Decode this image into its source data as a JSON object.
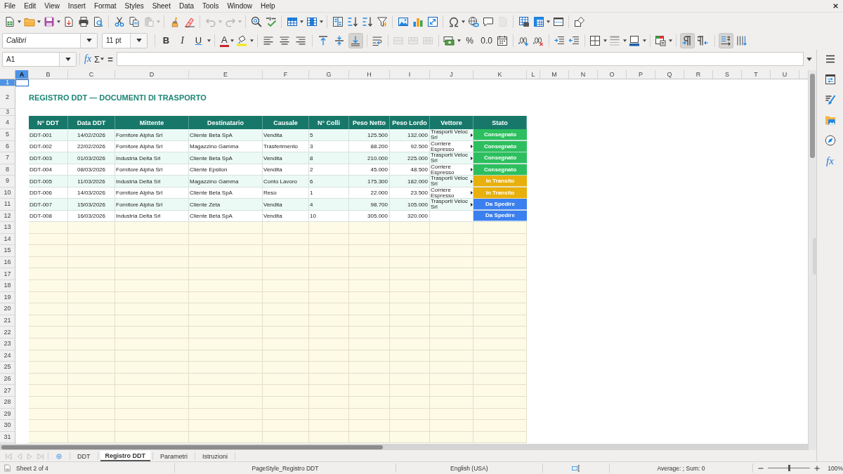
{
  "menu_bar": [
    "File",
    "Edit",
    "View",
    "Insert",
    "Format",
    "Styles",
    "Sheet",
    "Data",
    "Tools",
    "Window",
    "Help"
  ],
  "standard_toolbar": {
    "paste": {
      "disabled": true
    },
    "undo": {
      "disabled": true
    },
    "redo": {
      "disabled": true
    },
    "headers_footers": {
      "disabled": true
    }
  },
  "formatting_toolbar": {
    "font_name": "Calibri",
    "font_size": "11 pt",
    "bold": {
      "label": "B",
      "on": false
    },
    "italic": {
      "label": "I",
      "on": false
    },
    "underline": {
      "label": "U",
      "on": false
    },
    "font_color": {
      "label": "A"
    },
    "align_left": {
      "on": false
    },
    "align_center": {
      "on": false
    },
    "align_right": {
      "on": false
    },
    "align_top": {
      "on": false
    },
    "align_middle": {
      "on": false
    },
    "align_bottom": {
      "on": true
    },
    "merge": {
      "disabled": true
    },
    "percent": {
      "label": "%"
    },
    "decimal": {
      "label": "0.0"
    },
    "left_to_right": {
      "on": true
    },
    "right_to_left": {
      "on": false
    },
    "text_left_to_right": {
      "on": true
    },
    "text_top_to_bottom": {
      "on": false
    }
  },
  "formula_bar": {
    "cell_reference": "A1",
    "function_wizard": "fx",
    "sum": "Σ",
    "equals": "="
  },
  "column_headers": [
    {
      "label": "A",
      "selected": true
    },
    {
      "label": "B",
      "selected": false
    },
    {
      "label": "C",
      "selected": false
    },
    {
      "label": "D",
      "selected": false
    },
    {
      "label": "E",
      "selected": false
    },
    {
      "label": "F",
      "selected": false
    },
    {
      "label": "G",
      "selected": false
    },
    {
      "label": "H",
      "selected": false
    },
    {
      "label": "I",
      "selected": false
    },
    {
      "label": "J",
      "selected": false
    },
    {
      "label": "K",
      "selected": false
    },
    {
      "label": "L",
      "selected": false
    },
    {
      "label": "M",
      "selected": false
    },
    {
      "label": "N",
      "selected": false
    },
    {
      "label": "O",
      "selected": false
    },
    {
      "label": "P",
      "selected": false
    },
    {
      "label": "Q",
      "selected": false
    },
    {
      "label": "R",
      "selected": false
    },
    {
      "label": "S",
      "selected": false
    },
    {
      "label": "T",
      "selected": false
    },
    {
      "label": "U",
      "selected": false
    }
  ],
  "row_headers": [
    {
      "label": "1",
      "selected": true
    },
    {
      "label": "2",
      "selected": false
    },
    {
      "label": "3",
      "selected": false
    },
    {
      "label": "4",
      "selected": false
    },
    {
      "label": "5",
      "selected": false
    },
    {
      "label": "6",
      "selected": false
    },
    {
      "label": "7",
      "selected": false
    },
    {
      "label": "8",
      "selected": false
    },
    {
      "label": "9",
      "selected": false
    },
    {
      "label": "10",
      "selected": false
    },
    {
      "label": "11",
      "selected": false
    },
    {
      "label": "12",
      "selected": false
    },
    {
      "label": "13",
      "selected": false
    },
    {
      "label": "14",
      "selected": false
    },
    {
      "label": "15",
      "selected": false
    },
    {
      "label": "16",
      "selected": false
    },
    {
      "label": "17",
      "selected": false
    },
    {
      "label": "18",
      "selected": false
    },
    {
      "label": "19",
      "selected": false
    },
    {
      "label": "20",
      "selected": false
    },
    {
      "label": "21",
      "selected": false
    },
    {
      "label": "22",
      "selected": false
    },
    {
      "label": "23",
      "selected": false
    },
    {
      "label": "24",
      "selected": false
    },
    {
      "label": "25",
      "selected": false
    },
    {
      "label": "26",
      "selected": false
    },
    {
      "label": "27",
      "selected": false
    },
    {
      "label": "28",
      "selected": false
    },
    {
      "label": "29",
      "selected": false
    },
    {
      "label": "30",
      "selected": false
    },
    {
      "label": "31",
      "selected": false
    }
  ],
  "sheet": {
    "title": "REGISTRO DDT — DOCUMENTI DI TRASPORTO",
    "table": {
      "columns": [
        "N° DDT",
        "Data DDT",
        "Mittente",
        "Destinatario",
        "Causale",
        "N° Colli",
        "Peso Netto",
        "Peso Lordo",
        "Vettore",
        "Stato"
      ],
      "rows": [
        {
          "ddt": "DDT-001",
          "date": "14/02/2026",
          "sender": "Fornitore Alpha Srl",
          "recipient": "Cliente Beta SpA",
          "reason": "Vendita",
          "packages": "5",
          "net": "125.500",
          "gross": "132.000",
          "carrier": {
            "text": "Trasporti Veloc Srl",
            "clipped": true
          },
          "status": {
            "text": "Consegnato",
            "color": "#2dbf5f"
          }
        },
        {
          "ddt": "DDT-002",
          "date": "22/02/2026",
          "sender": "Fornitore Alpha Srl",
          "recipient": "Magazzino Gamma",
          "reason": "Trasferimento",
          "packages": "3",
          "net": "88.200",
          "gross": "92.500",
          "carrier": {
            "text": "Corriere Espresso",
            "clipped": true
          },
          "status": {
            "text": "Consegnato",
            "color": "#2dbf5f"
          }
        },
        {
          "ddt": "DDT-003",
          "date": "01/03/2026",
          "sender": "Industria Delta Srl",
          "recipient": "Cliente Beta SpA",
          "reason": "Vendita",
          "packages": "8",
          "net": "210.000",
          "gross": "225.000",
          "carrier": {
            "text": "Trasporti Veloc Srl",
            "clipped": true
          },
          "status": {
            "text": "Consegnato",
            "color": "#2dbf5f"
          }
        },
        {
          "ddt": "DDT-004",
          "date": "08/03/2026",
          "sender": "Fornitore Alpha Srl",
          "recipient": "Cliente Epsilon",
          "reason": "Vendita",
          "packages": "2",
          "net": "45.000",
          "gross": "48.500",
          "carrier": {
            "text": "Corriere Espresso",
            "clipped": true
          },
          "status": {
            "text": "Consegnato",
            "color": "#2dbf5f"
          }
        },
        {
          "ddt": "DDT-005",
          "date": "11/03/2026",
          "sender": "Industria Delta Srl",
          "recipient": "Magazzino Gamma",
          "reason": "Conto Lavoro",
          "packages": "6",
          "net": "175.300",
          "gross": "182.000",
          "carrier": {
            "text": "Trasporti Veloc Srl",
            "clipped": true
          },
          "status": {
            "text": "In Transito",
            "color": "#e8b00c"
          }
        },
        {
          "ddt": "DDT-006",
          "date": "14/03/2026",
          "sender": "Fornitore Alpha Srl",
          "recipient": "Cliente Beta SpA",
          "reason": "Reso",
          "packages": "1",
          "net": "22.000",
          "gross": "23.500",
          "carrier": {
            "text": "Corriere Espresso",
            "clipped": true
          },
          "status": {
            "text": "In Transito",
            "color": "#e8b00c"
          }
        },
        {
          "ddt": "DDT-007",
          "date": "15/03/2026",
          "sender": "Fornitore Alpha Srl",
          "recipient": "Cliente Zeta",
          "reason": "Vendita",
          "packages": "4",
          "net": "98.700",
          "gross": "105.000",
          "carrier": {
            "text": "Trasporti Veloc Srl",
            "clipped": true
          },
          "status": {
            "text": "Da Spedire",
            "color": "#3b80ef"
          }
        },
        {
          "ddt": "DDT-008",
          "date": "16/03/2026",
          "sender": "Industria Delta Srl",
          "recipient": "Cliente Beta SpA",
          "reason": "Vendita",
          "packages": "10",
          "net": "305.000",
          "gross": "320.000",
          "status": {
            "text": "Da Spedire",
            "color": "#3b80ef"
          }
        }
      ]
    }
  },
  "sheet_navigation": {
    "disabled": true
  },
  "sheet_tabs": [
    {
      "label": "DDT",
      "selected": false
    },
    {
      "label": "Registro DDT",
      "selected": true
    },
    {
      "label": "Parametri",
      "selected": false
    },
    {
      "label": "Istruzioni",
      "selected": false
    }
  ],
  "sidebar": {
    "functions": "fx"
  },
  "status_bar": {
    "sheet": "Sheet 2 of 4",
    "page_style": "PageStyle_Registro DDT",
    "language": "English (USA)",
    "selection_stats": "Average: ; Sum: 0",
    "zoom": {
      "level": 0.5,
      "reading": "100%"
    }
  }
}
